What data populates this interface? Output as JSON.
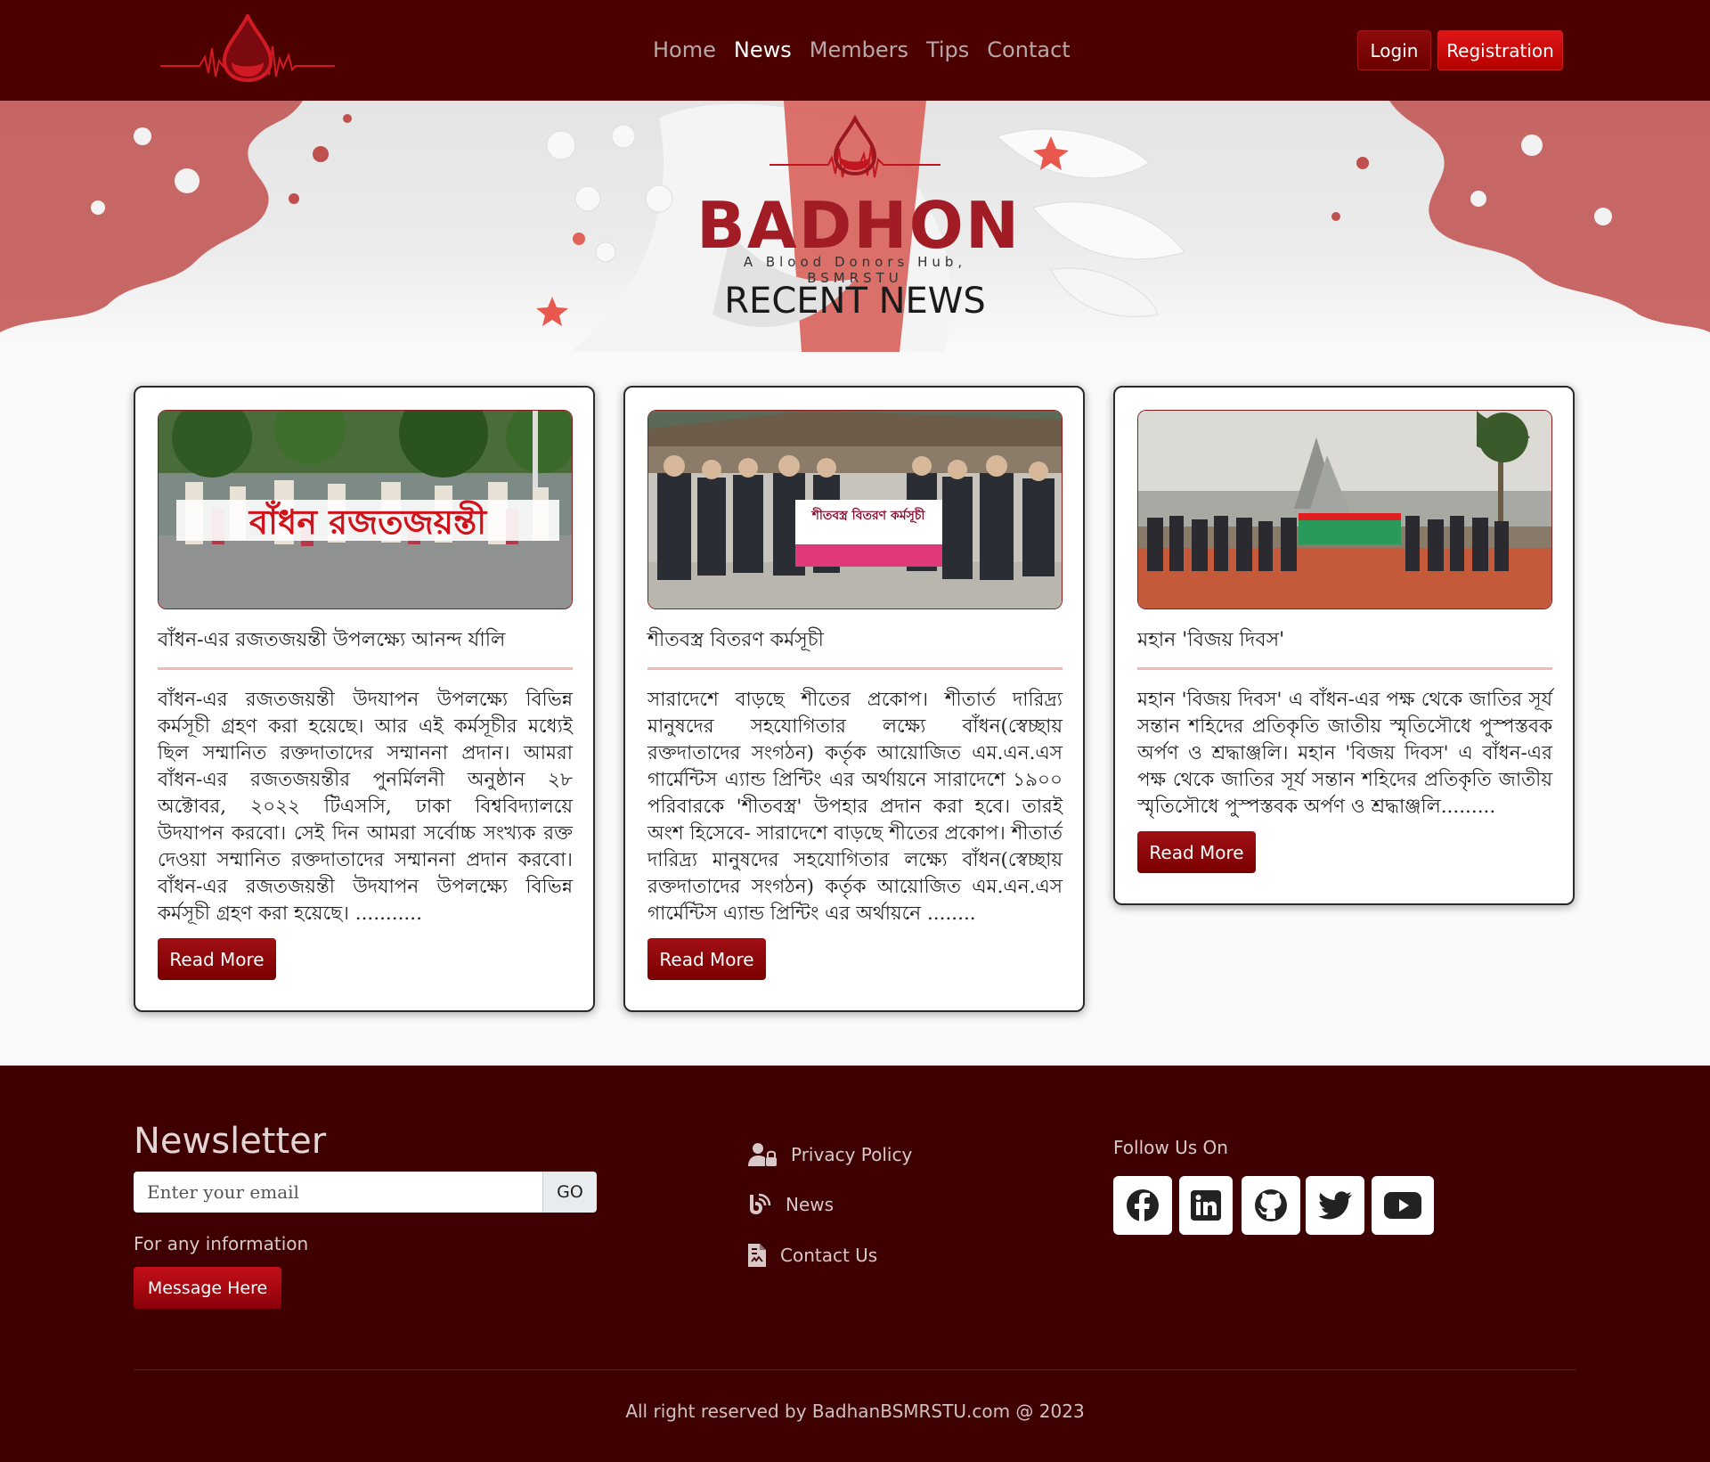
{
  "nav": {
    "links": [
      "Home",
      "News",
      "Members",
      "Tips",
      "Contact"
    ],
    "active": "News",
    "login_label": "Login",
    "register_label": "Registration"
  },
  "hero": {
    "brand": "BADHON",
    "tagline": "A Blood Donors Hub, BSMRSTU",
    "title": "RECENT NEWS"
  },
  "news": [
    {
      "title": "বাঁধন-এর রজতজয়ন্তী উপলক্ষ্যে আনন্দ র্যালি",
      "body": "বাঁধন-এর রজতজয়ন্তী উদযাপন উপলক্ষ্যে বিভিন্ন কর্মসূচী গ্রহণ করা হয়েছে। আর এই কর্মসূচীর মধ্যেই ছিল সম্মানিত রক্তদাতাদের সম্মাননা প্রদান। আমরা বাঁধন-এর রজতজয়ন্তীর পুনর্মিলনী অনুষ্ঠান ২৮ অক্টোবর, ২০২২ টিএসসি, ঢাকা বিশ্ববিদ্যালয়ে উদযাপন করবো। সেই দিন আমরা সর্বোচ্চ সংখ্যক রক্ত দেওয়া সম্মানিত রক্তদাতাদের সম্মাননা প্রদান করবো। বাঁধন-এর রজতজয়ন্তী উদযাপন উপলক্ষ্যে বিভিন্ন কর্মসূচী গ্রহণ করা হয়েছে। ...........",
      "button": "Read More",
      "banner_text": "বাঁধন রজতজয়ন্তী"
    },
    {
      "title": "শীতবস্ত্র বিতরণ কর্মসূচী",
      "body": "সারাদেশে বাড়ছে শীতের প্রকোপ। শীতার্ত দারিদ্র্য মানুষদের সহযোগিতার লক্ষ্যে বাঁধন(স্বেচ্ছায় রক্তদাতাদের সংগঠন) কর্তৃক আয়োজিত এম.এন.এস গার্মেন্টিস এ্যান্ড প্রিন্টিং এর অর্থায়নে সারাদেশে ১৯০০ পরিবারকে 'শীতবস্ত্র' উপহার প্রদান করা হবে। তারই অংশ হিসেবে- সারাদেশে বাড়ছে শীতের প্রকোপ। শীতার্ত দারিদ্র্য মানুষদের সহযোগিতার লক্ষ্যে বাঁধন(স্বেচ্ছায় রক্তদাতাদের সংগঠন) কর্তৃক আয়োজিত এম.এন.এস গার্মেন্টিস এ্যান্ড প্রিন্টিং এর অর্থায়নে ........",
      "button": "Read More",
      "banner_text": "শীতবস্ত্র বিতরণ কর্মসূচী"
    },
    {
      "title": "মহান 'বিজয় দিবস'",
      "body": "মহান 'বিজয় দিবস' এ বাঁধন-এর পক্ষ থেকে জাতির সূর্য সন্তান শহিদের প্রতিকৃতি জাতীয় স্মৃতিসৌধে পুস্পস্তবক অর্পণ ও শ্রদ্ধাঞ্জলি। মহান 'বিজয় দিবস' এ বাঁধন-এর পক্ষ থেকে জাতির সূর্য সন্তান শহিদের প্রতিকৃতি জাতীয় স্মৃতিসৌধে পুস্পস্তবক অর্পণ ও শ্রদ্ধাঞ্জলি.........",
      "button": "Read More"
    }
  ],
  "footer": {
    "newsletter_title": "Newsletter",
    "email_placeholder": "Enter your email",
    "go_label": "GO",
    "info_text": "For any information",
    "message_label": "Message Here",
    "links": [
      "Privacy Policy",
      "News",
      "Contact Us"
    ],
    "follow_title": "Follow Us On",
    "social_icons": [
      "facebook-icon",
      "linkedin-icon",
      "github-icon",
      "twitter-icon",
      "youtube-icon"
    ],
    "copyright": "All right reserved by BadhanBSMRSTU.com @ 2023"
  },
  "colors": {
    "nav_bg": "#4d0000",
    "footer_bg": "#3f0002",
    "accent": "#a00f14",
    "brand_red": "#a11c25"
  }
}
